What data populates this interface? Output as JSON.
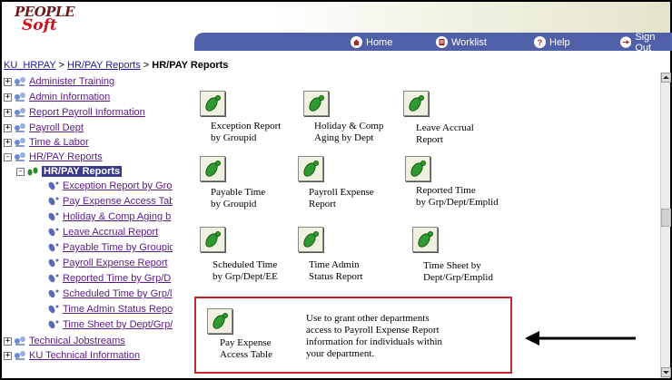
{
  "logo": {
    "line1": "PEOPLE",
    "line2": "Soft"
  },
  "nav": {
    "home": "Home",
    "worklist": "Worklist",
    "help": "Help",
    "signout": "Sign Out"
  },
  "breadcrumb": {
    "root": "KU_HRPAY",
    "sep1": " > ",
    "parent": "HR/PAY Reports",
    "sep2": " > ",
    "current": "HR/PAY Reports"
  },
  "tree": [
    {
      "label": "Administer Training",
      "toggle": "+"
    },
    {
      "label": "Admin Information",
      "toggle": "+"
    },
    {
      "label": "Report Payroll Information",
      "toggle": "+"
    },
    {
      "label": "Payroll Dept",
      "toggle": "+"
    },
    {
      "label": "Time & Labor",
      "toggle": "+"
    },
    {
      "label": "HR/PAY Reports",
      "toggle": "-"
    },
    {
      "label": "HR/PAY Reports",
      "toggle": "-"
    },
    {
      "label": "Exception Report by Grou"
    },
    {
      "label": "Pay Expense Access Tab"
    },
    {
      "label": "Holiday & Comp Aging b"
    },
    {
      "label": "Leave Accrual Report"
    },
    {
      "label": "Payable Time by Groupic"
    },
    {
      "label": "Payroll Expense Report"
    },
    {
      "label": "Reported Time by Grp/D"
    },
    {
      "label": "Scheduled Time by Grp/l"
    },
    {
      "label": "Time Admin Status Repo"
    },
    {
      "label": "Time Sheet by Dept/Grp/"
    },
    {
      "label": "Technical Jobstreams",
      "toggle": "+"
    },
    {
      "label": "KU Technical Information",
      "toggle": "+"
    }
  ],
  "reports": [
    {
      "l1": "Exception Report",
      "l2": "by Groupid"
    },
    {
      "l1": "Holiday & Comp",
      "l2": "Aging by Dept"
    },
    {
      "l1": "Leave Accrual",
      "l2": "Report"
    },
    {
      "l1": "Payable Time",
      "l2": "by Groupid"
    },
    {
      "l1": "Payroll Expense",
      "l2": "Report"
    },
    {
      "l1": "Reported Time",
      "l2": "by Grp/Dept/Emplid"
    },
    {
      "l1": "Scheduled Time",
      "l2": "by Grp/Dept/EE"
    },
    {
      "l1": "Time Admin",
      "l2": "Status Report"
    },
    {
      "l1": "Time Sheet by",
      "l2": "Dept/Grp/Emplid"
    },
    {
      "l1": "Pay Expense",
      "l2": "Access Table"
    }
  ],
  "description": {
    "line1": "Use to grant other departments",
    "line2": "access to Payroll Expense Report",
    "line3": "information for individuals within",
    "line4": "your department."
  },
  "colors": {
    "navbar": "#5060a8",
    "highlight_border": "#c0282d",
    "tree_link": "#5b1a8a",
    "selected_bg": "#3a3a8c"
  }
}
